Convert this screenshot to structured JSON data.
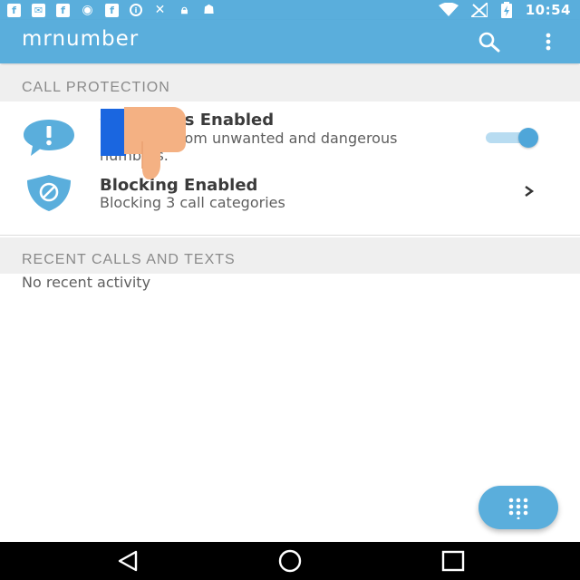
{
  "status_bar": {
    "time": "10:54",
    "notification_icons": [
      "facebook-icon",
      "mail-icon",
      "facebook-icon",
      "eye-icon",
      "facebook-icon",
      "info-icon",
      "tool-icon",
      "lock-icon",
      "android-icon"
    ],
    "system_icons": [
      "wifi-icon",
      "no-signal-icon",
      "battery-charging-icon"
    ]
  },
  "app_bar": {
    "logo": "mrnumber",
    "actions": [
      "search-icon",
      "more-vert-icon"
    ]
  },
  "call_protection": {
    "header": "CALL PROTECTION",
    "alerts": {
      "title": "Call Alerts Enabled",
      "subtitle": "Protected from unwanted and dangerous numbers.",
      "toggle_on": true
    },
    "blocking": {
      "title": "Blocking Enabled",
      "subtitle": "Blocking 3 call categories"
    }
  },
  "recent": {
    "header": "RECENT CALLS AND TEXTS",
    "empty": "No recent activity"
  },
  "nav_bar": {
    "buttons": [
      "back-icon",
      "home-icon",
      "recents-icon"
    ]
  },
  "colors": {
    "primary": "#5aaedc",
    "accent": "#4fa6d9",
    "section_bg": "#efefef"
  }
}
